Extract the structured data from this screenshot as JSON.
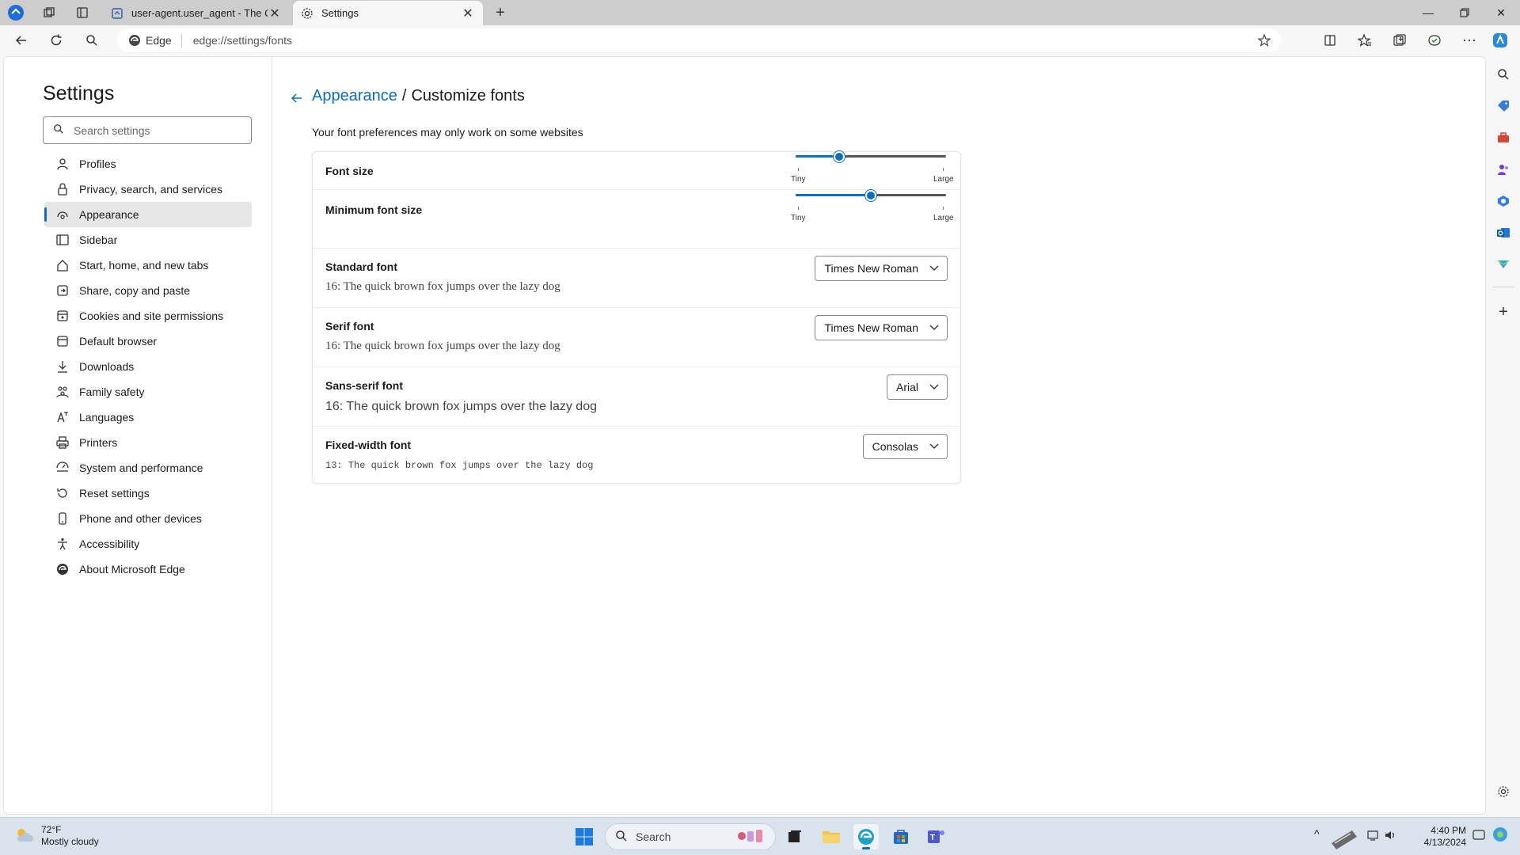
{
  "browser": {
    "tabs": [
      {
        "title": "user-agent.user_agent - The Coll",
        "icon": "doc-page-icon"
      },
      {
        "title": "Settings",
        "icon": "gear-icon"
      }
    ],
    "address": {
      "identity": "Edge",
      "url": "edge://settings/fonts"
    }
  },
  "settings": {
    "title": "Settings",
    "search_placeholder": "Search settings",
    "nav": [
      {
        "label": "Profiles",
        "icon": "profile-icon"
      },
      {
        "label": "Privacy, search, and services",
        "icon": "lock-icon"
      },
      {
        "label": "Appearance",
        "icon": "appearance-icon",
        "selected": true
      },
      {
        "label": "Sidebar",
        "icon": "sidebar-icon"
      },
      {
        "label": "Start, home, and new tabs",
        "icon": "home-icon"
      },
      {
        "label": "Share, copy and paste",
        "icon": "share-icon"
      },
      {
        "label": "Cookies and site permissions",
        "icon": "cookie-icon"
      },
      {
        "label": "Default browser",
        "icon": "browser-icon"
      },
      {
        "label": "Downloads",
        "icon": "download-icon"
      },
      {
        "label": "Family safety",
        "icon": "family-icon"
      },
      {
        "label": "Languages",
        "icon": "languages-icon"
      },
      {
        "label": "Printers",
        "icon": "printer-icon"
      },
      {
        "label": "System and performance",
        "icon": "system-icon"
      },
      {
        "label": "Reset settings",
        "icon": "reset-icon"
      },
      {
        "label": "Phone and other devices",
        "icon": "phone-icon"
      },
      {
        "label": "Accessibility",
        "icon": "accessibility-icon"
      },
      {
        "label": "About Microsoft Edge",
        "icon": "edge-logo-icon"
      }
    ]
  },
  "page": {
    "breadcrumb_parent": "Appearance",
    "breadcrumb_sep": "/",
    "breadcrumb_current": "Customize fonts",
    "note": "Your font preferences may only work on some websites",
    "font_size": {
      "label": "Font size",
      "value_fraction": 0.29,
      "min_label": "Tiny",
      "max_label": "Large"
    },
    "min_font_size": {
      "label": "Minimum font size",
      "value_fraction": 0.5,
      "min_label": "Tiny",
      "max_label": "Large"
    },
    "fonts": [
      {
        "label": "Standard font",
        "value": "Times New Roman",
        "preview": "16: The quick brown fox jumps over the lazy dog"
      },
      {
        "label": "Serif font",
        "value": "Times New Roman",
        "preview": "16: The quick brown fox jumps over the lazy dog"
      },
      {
        "label": "Sans-serif font",
        "value": "Arial",
        "preview": "16: The quick brown fox jumps over the lazy dog"
      },
      {
        "label": "Fixed-width font",
        "value": "Consolas",
        "preview": "13: The quick brown fox jumps over the lazy dog"
      }
    ]
  },
  "taskbar": {
    "weather_temp": "72°F",
    "weather_desc": "Mostly cloudy",
    "search_label": "Search",
    "time": "4:40 PM",
    "date": "4/13/2024"
  },
  "colors": {
    "accent": "#0f6cbd"
  }
}
